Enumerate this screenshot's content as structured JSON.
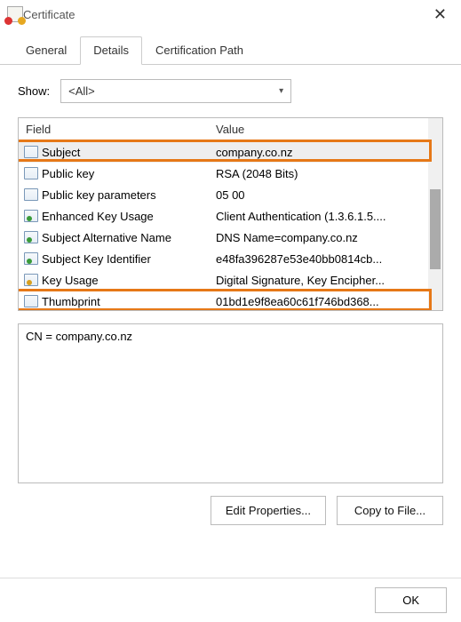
{
  "window": {
    "title": "Certificate"
  },
  "tabs": {
    "general": "General",
    "details": "Details",
    "certpath": "Certification Path"
  },
  "show": {
    "label": "Show:",
    "value": "<All>"
  },
  "list": {
    "header_field": "Field",
    "header_value": "Value",
    "rows": [
      {
        "field": "Subject",
        "value": "company.co.nz",
        "icon": "plain",
        "selected": true
      },
      {
        "field": "Public key",
        "value": "RSA (2048 Bits)",
        "icon": "plain"
      },
      {
        "field": "Public key parameters",
        "value": "05 00",
        "icon": "plain"
      },
      {
        "field": "Enhanced Key Usage",
        "value": "Client Authentication (1.3.6.1.5....",
        "icon": "ext"
      },
      {
        "field": "Subject Alternative Name",
        "value": "DNS Name=company.co.nz",
        "icon": "ext"
      },
      {
        "field": "Subject Key Identifier",
        "value": "e48fa396287e53e40bb0814cb...",
        "icon": "ext"
      },
      {
        "field": "Key Usage",
        "value": "Digital Signature, Key Encipher...",
        "icon": "key"
      },
      {
        "field": "Thumbprint",
        "value": "01bd1e9f8ea60c61f746bd368...",
        "icon": "plain"
      }
    ]
  },
  "detail": "CN = company.co.nz",
  "buttons": {
    "edit": "Edit Properties...",
    "copy": "Copy to File...",
    "ok": "OK"
  }
}
